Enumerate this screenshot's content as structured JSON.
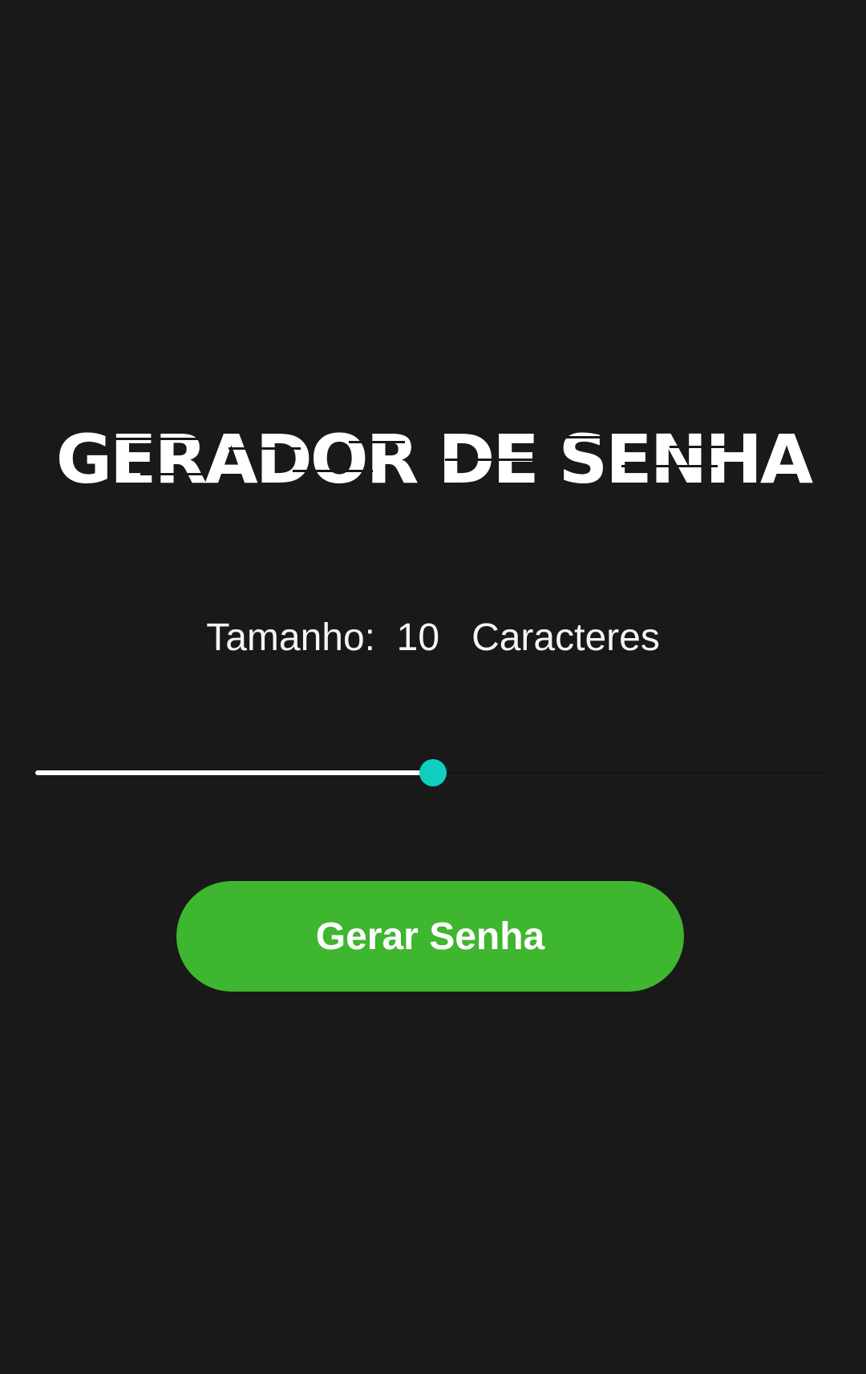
{
  "app": {
    "title": "GERADOR DE SENHA"
  },
  "size": {
    "label": "Tamanho:",
    "value": "10",
    "unit": "Caracteres"
  },
  "slider": {
    "fraction": 0.5
  },
  "button": {
    "label": "Gerar Senha"
  },
  "colors": {
    "background": "#191919",
    "accent_thumb": "#0ecfc0",
    "button": "#3fb62f",
    "text": "#ffffff"
  }
}
